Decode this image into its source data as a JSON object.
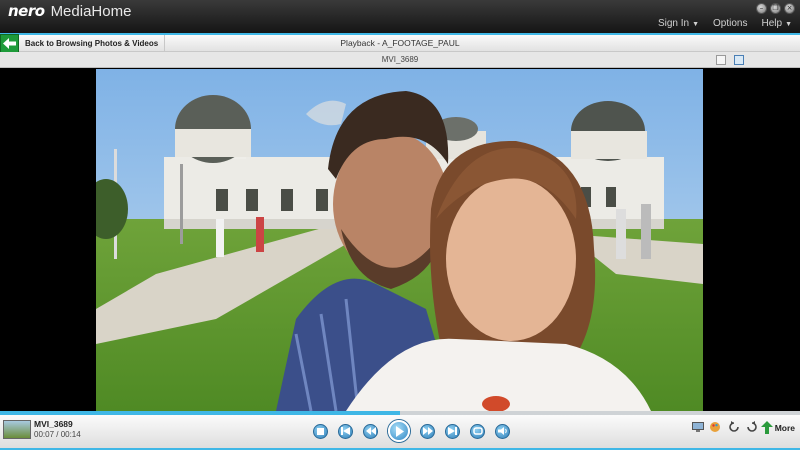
{
  "app": {
    "brand": "nero",
    "name": "MediaHome"
  },
  "window_controls": [
    {
      "name": "minimize-button",
      "glyph": "–"
    },
    {
      "name": "restore-button",
      "glyph": "❐"
    },
    {
      "name": "close-button",
      "glyph": "×"
    }
  ],
  "top_menu": {
    "sign_in": "Sign In",
    "options": "Options",
    "help": "Help"
  },
  "nav": {
    "back_label": "Back to Browsing Photos & Videos",
    "title": "Playback - A_FOOTAGE_PAUL"
  },
  "subbar": {
    "title": "MVI_3689"
  },
  "clip": {
    "name": "MVI_3689",
    "time": "00:07 / 00:14",
    "progress": 0.5
  },
  "tools": [
    "screen-icon",
    "paint-icon",
    "rotate-left-icon",
    "rotate-right-icon"
  ],
  "more_label": "More",
  "colors": {
    "accent": "#3fb7e6",
    "back_green": "#1e9b3a",
    "transport_blue": "#2f7fb8"
  }
}
